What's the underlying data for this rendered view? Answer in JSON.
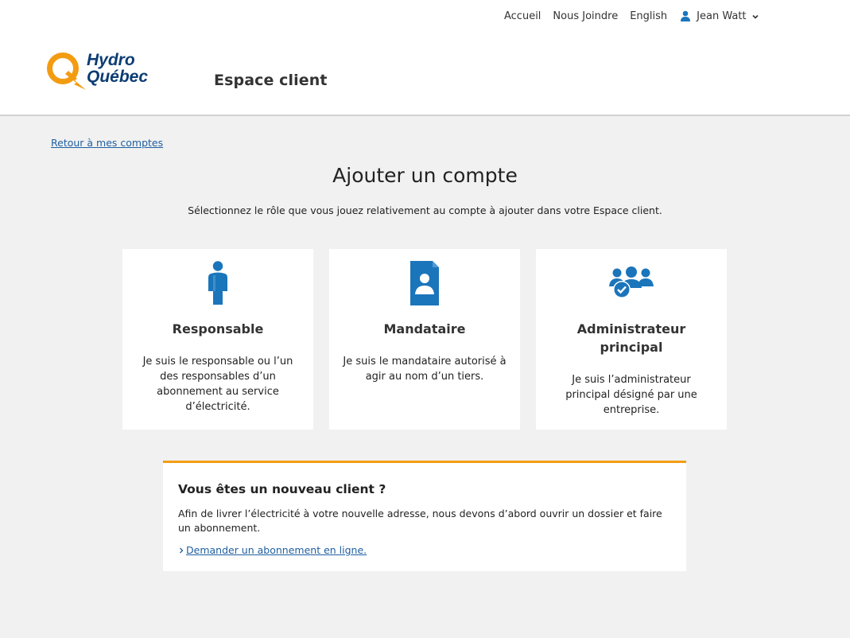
{
  "header": {
    "logo_text_line1": "Hydro",
    "logo_text_line2": "Québec",
    "site_title": "Espace client",
    "nav": {
      "accueil": "Accueil",
      "nous_joindre": "Nous Joindre",
      "language": "English",
      "user_name": "Jean Watt"
    }
  },
  "main": {
    "back_link": "Retour à mes comptes",
    "title": "Ajouter un compte",
    "subtitle": "Sélectionnez le rôle que vous jouez relativement au compte à ajouter dans votre Espace client.",
    "cards": [
      {
        "icon": "person-icon",
        "title": "Responsable",
        "description": "Je suis le responsable ou l’un des responsables d’un abonnement au service d’électricité."
      },
      {
        "icon": "id-card-icon",
        "title": "Mandataire",
        "description": "Je suis le mandataire autorisé à agir au nom d’un tiers."
      },
      {
        "icon": "group-check-icon",
        "title": "Administrateur principal",
        "description": "Je suis l’administrateur principal désigné par une entreprise."
      }
    ],
    "notice": {
      "title": "Vous êtes un nouveau client ?",
      "text": "Afin de livrer l’électricité à votre nouvelle adresse, nous devons d’abord ouvrir un dossier et faire un abonnement.",
      "link": "Demander un abonnement en ligne."
    }
  },
  "colors": {
    "brand_orange": "#f39c12",
    "brand_blue": "#1b75bb",
    "link_blue": "#1f5fa0",
    "logo_navy": "#0b3c73"
  }
}
